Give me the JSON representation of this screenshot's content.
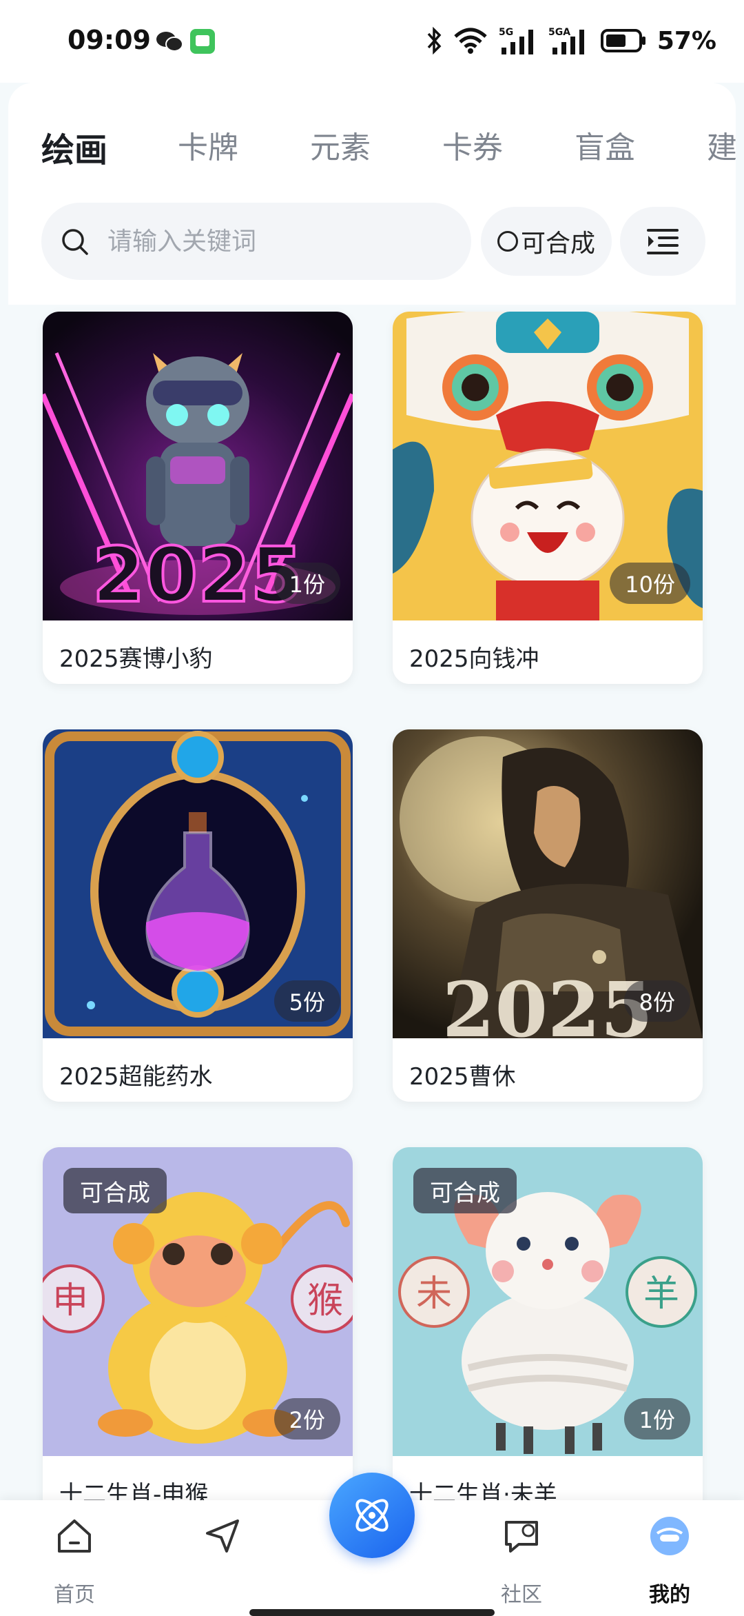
{
  "status_bar": {
    "time": "09:09",
    "battery": "57%",
    "icons": [
      "wechat-icon",
      "message-app-icon",
      "bluetooth-icon",
      "wifi-icon",
      "signal-5g-icon",
      "signal-5ga-icon",
      "battery-icon"
    ]
  },
  "tabs": [
    {
      "label": "绘画",
      "active": true
    },
    {
      "label": "卡牌",
      "active": false
    },
    {
      "label": "元素",
      "active": false
    },
    {
      "label": "卡券",
      "active": false
    },
    {
      "label": "盲盒",
      "active": false
    },
    {
      "label": "建",
      "active": false
    }
  ],
  "search": {
    "placeholder": "请输入关键词",
    "value": ""
  },
  "filter": {
    "synthesizable_label": "可合成",
    "synthesizable_checked": false
  },
  "items": [
    {
      "title": "2025赛博小豹",
      "count": "1份",
      "tag": ""
    },
    {
      "title": "2025向钱冲",
      "count": "10份",
      "tag": ""
    },
    {
      "title": "2025超能药水",
      "count": "5份",
      "tag": ""
    },
    {
      "title": "2025曹休",
      "count": "8份",
      "tag": ""
    },
    {
      "title": "十二生肖-申猴",
      "count": "2份",
      "tag": "可合成"
    },
    {
      "title": "十二生肖·未羊",
      "count": "1份",
      "tag": "可合成"
    }
  ],
  "artwork_text": {
    "year_2025": "2025",
    "monkey_char": "申",
    "monkey_char2": "猴",
    "goat_char": "未",
    "goat_char2": "羊"
  },
  "bottom_nav": {
    "items": [
      {
        "label": "首页",
        "icon": "home-icon",
        "active": false
      },
      {
        "label": "",
        "icon": "send-icon",
        "active": false
      },
      {
        "label": "",
        "icon": "atom-icon",
        "active": false
      },
      {
        "label": "社区",
        "icon": "community-icon",
        "active": false
      },
      {
        "label": "我的",
        "icon": "avatar-icon",
        "active": true
      }
    ]
  },
  "colors": {
    "accent": "#3ab7e8",
    "fab": "#2a7af2"
  }
}
